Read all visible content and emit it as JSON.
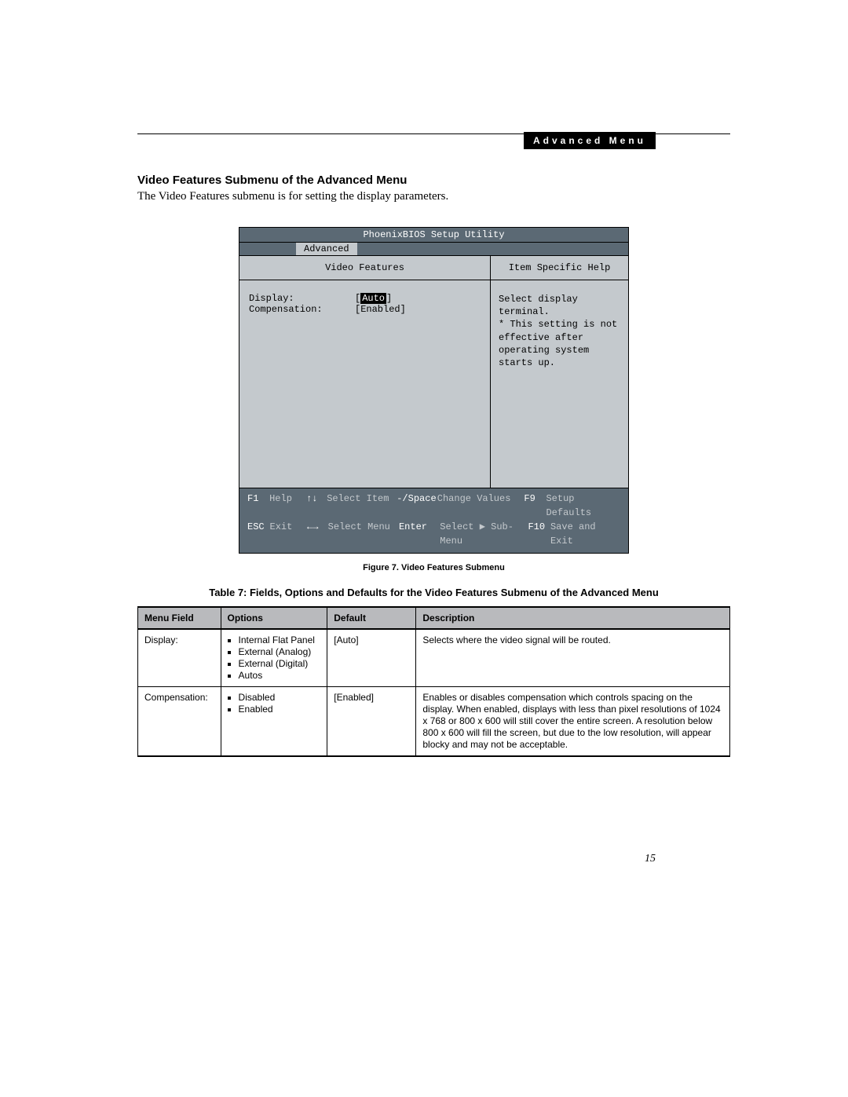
{
  "header_bar": "Advanced Menu",
  "section_title": "Video Features Submenu of the Advanced Menu",
  "intro_text": "The Video Features submenu is for setting the display parameters.",
  "bios": {
    "title": "PhoenixBIOS Setup Utility",
    "tab": "Advanced",
    "left_header": "Video Features",
    "right_header": "Item Specific Help",
    "rows": [
      {
        "label": "Display:",
        "value": "Auto",
        "selected": true
      },
      {
        "label": "Compensation:",
        "value": "[Enabled]",
        "selected": false
      }
    ],
    "help_lines": [
      "Select display terminal.",
      "",
      "* This setting is not",
      "effective after",
      "operating system",
      "starts up."
    ],
    "footer": {
      "row1": {
        "k1": "F1",
        "v1": "Help",
        "k2": "↑↓",
        "v2": "Select Item",
        "k3": "-/Space",
        "v3": "Change Values",
        "k4": "F9",
        "v4": "Setup Defaults"
      },
      "row2": {
        "k1": "ESC",
        "v1": "Exit",
        "k2": "←→",
        "v2": "Select Menu",
        "k3": "Enter",
        "v3": "Select ▶ Sub-Menu",
        "k4": "F10",
        "v4": "Save and Exit"
      }
    }
  },
  "figure_caption": "Figure 7.  Video Features Submenu",
  "table_caption": "Table 7: Fields, Options and Defaults for the Video Features Submenu of the Advanced Menu",
  "table": {
    "headers": [
      "Menu Field",
      "Options",
      "Default",
      "Description"
    ],
    "rows": [
      {
        "field": "Display:",
        "options": [
          "Internal Flat Panel",
          "External (Analog)",
          "External (Digital)",
          "Autos"
        ],
        "default": "[Auto]",
        "description": "Selects where the video signal will be routed."
      },
      {
        "field": "Compensation:",
        "options": [
          "Disabled",
          "Enabled"
        ],
        "default": "[Enabled]",
        "description": "Enables or disables compensation which controls spacing on the display. When enabled, displays with less than pixel resolutions of 1024 x 768 or 800 x 600 will still cover the entire screen. A resolution below 800 x 600 will fill the screen, but due to the low resolution, will appear blocky and may not be acceptable."
      }
    ]
  },
  "page_number": "15"
}
